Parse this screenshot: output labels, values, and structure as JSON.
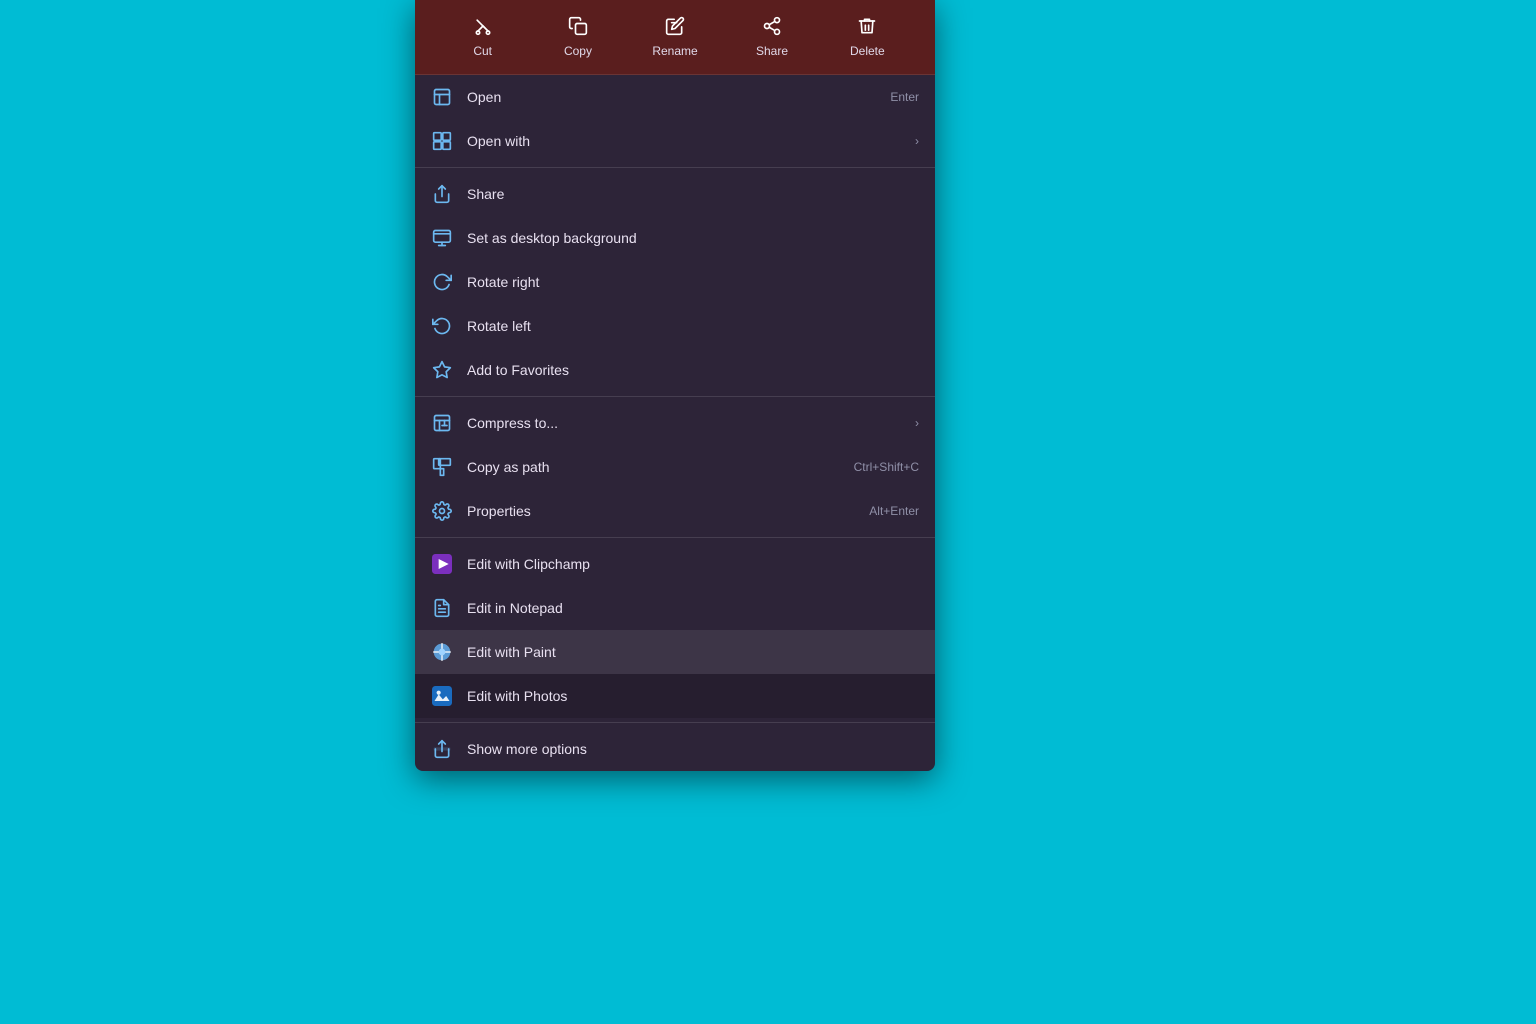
{
  "background": {
    "color": "#00bcd4"
  },
  "contextMenu": {
    "toolbar": {
      "items": [
        {
          "id": "cut",
          "label": "Cut",
          "icon": "cut"
        },
        {
          "id": "copy",
          "label": "Copy",
          "icon": "copy"
        },
        {
          "id": "rename",
          "label": "Rename",
          "icon": "rename"
        },
        {
          "id": "share",
          "label": "Share",
          "icon": "share"
        },
        {
          "id": "delete",
          "label": "Delete",
          "icon": "delete"
        }
      ]
    },
    "menuItems": [
      {
        "id": "open",
        "label": "Open",
        "shortcut": "Enter",
        "hasArrow": false,
        "icon": "open"
      },
      {
        "id": "open-with",
        "label": "Open with",
        "shortcut": "",
        "hasArrow": true,
        "icon": "open-with"
      },
      {
        "id": "share",
        "label": "Share",
        "shortcut": "",
        "hasArrow": false,
        "icon": "share-menu"
      },
      {
        "id": "set-desktop",
        "label": "Set as desktop background",
        "shortcut": "",
        "hasArrow": false,
        "icon": "desktop"
      },
      {
        "id": "rotate-right",
        "label": "Rotate right",
        "shortcut": "",
        "hasArrow": false,
        "icon": "rotate-right"
      },
      {
        "id": "rotate-left",
        "label": "Rotate left",
        "shortcut": "",
        "hasArrow": false,
        "icon": "rotate-left"
      },
      {
        "id": "add-favorites",
        "label": "Add to Favorites",
        "shortcut": "",
        "hasArrow": false,
        "icon": "star"
      },
      {
        "id": "compress",
        "label": "Compress to...",
        "shortcut": "",
        "hasArrow": true,
        "icon": "compress"
      },
      {
        "id": "copy-path",
        "label": "Copy as path",
        "shortcut": "Ctrl+Shift+C",
        "hasArrow": false,
        "icon": "copy-path"
      },
      {
        "id": "properties",
        "label": "Properties",
        "shortcut": "Alt+Enter",
        "hasArrow": false,
        "icon": "properties"
      },
      {
        "id": "edit-clipchamp",
        "label": "Edit with Clipchamp",
        "shortcut": "",
        "hasArrow": false,
        "icon": "clipchamp",
        "sectionStart": true
      },
      {
        "id": "edit-notepad",
        "label": "Edit in Notepad",
        "shortcut": "",
        "hasArrow": false,
        "icon": "notepad"
      },
      {
        "id": "edit-paint",
        "label": "Edit with Paint",
        "shortcut": "",
        "hasArrow": false,
        "icon": "paint",
        "highlighted": true
      },
      {
        "id": "edit-photos",
        "label": "Edit with Photos",
        "shortcut": "",
        "hasArrow": false,
        "icon": "photos"
      },
      {
        "id": "show-more",
        "label": "Show more options",
        "shortcut": "",
        "hasArrow": false,
        "icon": "more",
        "sectionStart": true
      }
    ]
  }
}
